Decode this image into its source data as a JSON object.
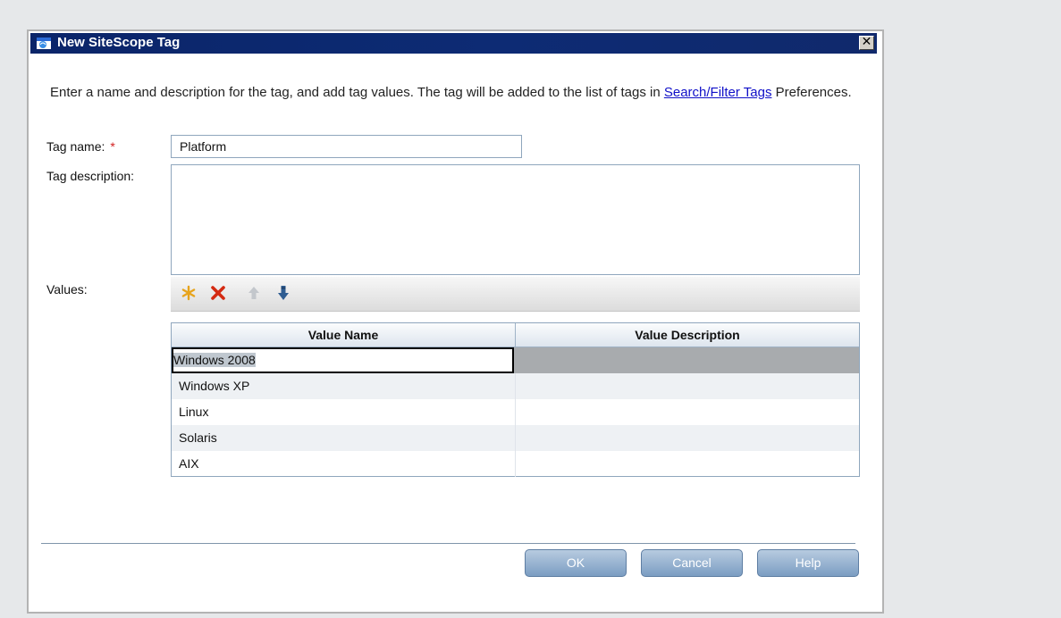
{
  "dialog": {
    "title": "New SiteScope Tag",
    "close_glyph": "✕",
    "intro_before": "Enter a name and description for the tag, and add tag values. The tag will be added to the list of tags in ",
    "intro_link": "Search/Filter Tags",
    "intro_after": " Preferences."
  },
  "form": {
    "tag_name_label": "Tag name:",
    "required_marker": "*",
    "tag_name_value": "Platform",
    "tag_description_label": "Tag description:",
    "tag_description_value": "",
    "values_label": "Values:"
  },
  "toolbar": {
    "icons": [
      "new-value-icon",
      "delete-value-icon",
      "move-up-icon",
      "move-down-icon"
    ]
  },
  "grid": {
    "columns": [
      "Value Name",
      "Value Description"
    ],
    "rows": [
      {
        "name": "Windows 2008",
        "description": ""
      },
      {
        "name": "Windows XP",
        "description": ""
      },
      {
        "name": "Linux",
        "description": ""
      },
      {
        "name": "Solaris",
        "description": ""
      },
      {
        "name": "AIX",
        "description": ""
      }
    ]
  },
  "buttons": {
    "ok": "OK",
    "cancel": "Cancel",
    "help": "Help"
  },
  "colors": {
    "title_bar": "#0d2b74",
    "button": "#8fabca",
    "link": "#1010c8",
    "required": "#d21f1f"
  }
}
